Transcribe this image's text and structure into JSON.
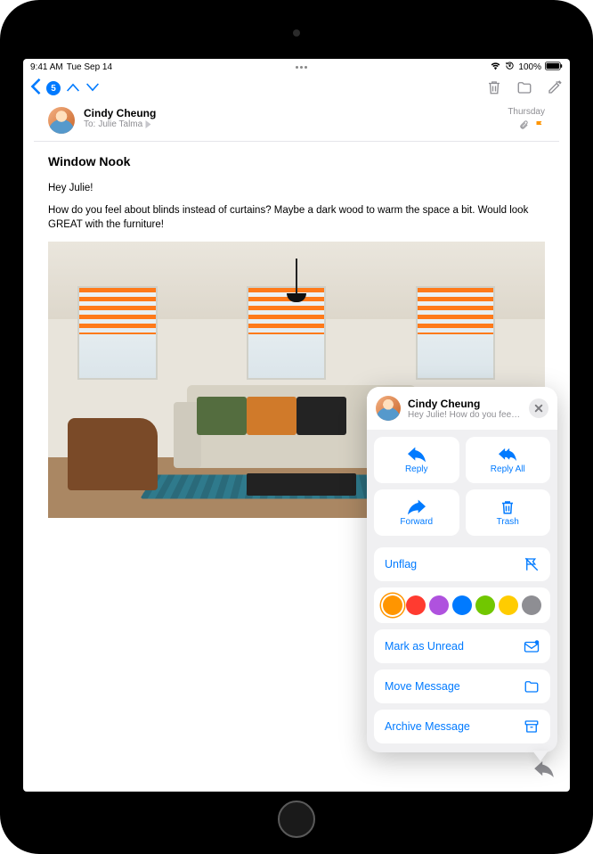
{
  "status_bar": {
    "time": "9:41 AM",
    "date": "Tue Sep 14",
    "battery": "100%"
  },
  "nav": {
    "back_count": "5"
  },
  "message": {
    "from": "Cindy Cheung",
    "to_label": "To:",
    "to_name": "Julie Talma",
    "date": "Thursday",
    "subject": "Window Nook",
    "greeting": "Hey Julie!",
    "body": "How do you feel about blinds instead of curtains? Maybe a dark wood to warm the space a bit. Would look GREAT with the furniture!"
  },
  "popover": {
    "name": "Cindy Cheung",
    "preview": "Hey Julie! How do you feel ab...",
    "actions": {
      "reply": "Reply",
      "reply_all": "Reply All",
      "forward": "Forward",
      "trash": "Trash"
    },
    "unflag": "Unflag",
    "flag_colors": [
      "#ff9500",
      "#ff3b30",
      "#af52de",
      "#007aff",
      "#71c700",
      "#ffcc00",
      "#8e8e93"
    ],
    "selected_flag_index": 0,
    "mark_unread": "Mark as Unread",
    "move": "Move Message",
    "archive": "Archive Message"
  }
}
